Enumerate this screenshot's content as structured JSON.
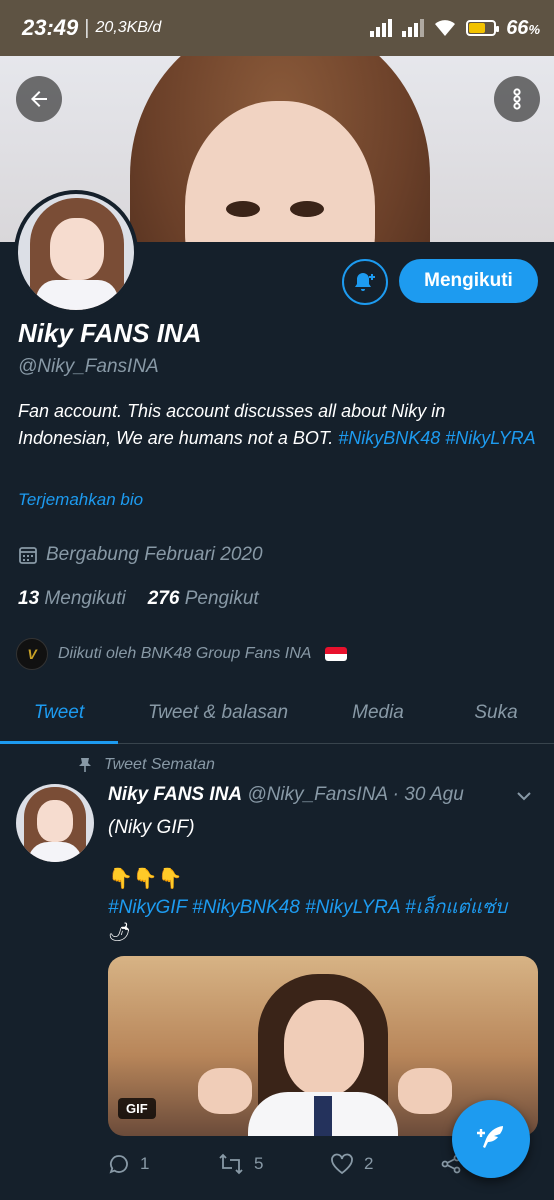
{
  "status_bar": {
    "time": "23:49",
    "speed": "20,3KB/d",
    "battery_pct": "66",
    "battery_level": 0.66
  },
  "profile": {
    "name": "Niky FANS INA",
    "handle": "@Niky_FansINA",
    "bio_text": "Fan account. This account discusses all about Niky in Indonesian, We are humans not a BOT.",
    "bio_tags": [
      "#NikyBNK48",
      "#NikyLYRA"
    ],
    "translate_label": "Terjemahkan bio",
    "joined": "Bergabung Februari 2020",
    "following_count": "13",
    "following_label": "Mengikuti",
    "followers_count": "276",
    "followers_label": "Pengikut",
    "followed_by": "Diikuti oleh BNK48 Group Fans INA",
    "follow_button": "Mengikuti"
  },
  "tabs": [
    {
      "label": "Tweet",
      "active": true
    },
    {
      "label": "Tweet & balasan",
      "active": false
    },
    {
      "label": "Media",
      "active": false
    },
    {
      "label": "Suka",
      "active": false
    }
  ],
  "tweet": {
    "pinned_label": "Tweet Sematan",
    "author": "Niky FANS INA",
    "meta": "@Niky_FansINA · 30 Agu",
    "text": "(Niky GIF)",
    "emojis": "👇👇👇",
    "hashtags": "#NikyGIF #NikyBNK48 #NikyLYRA #เล็กแต่แซ่บ",
    "chili": "🌶",
    "media_badge": "GIF",
    "replies": "1",
    "retweets": "5",
    "likes": "2"
  },
  "colors": {
    "accent": "#1d9bf0",
    "background": "#15202b",
    "muted": "#8899a6",
    "status_bar": "#5e5343"
  }
}
